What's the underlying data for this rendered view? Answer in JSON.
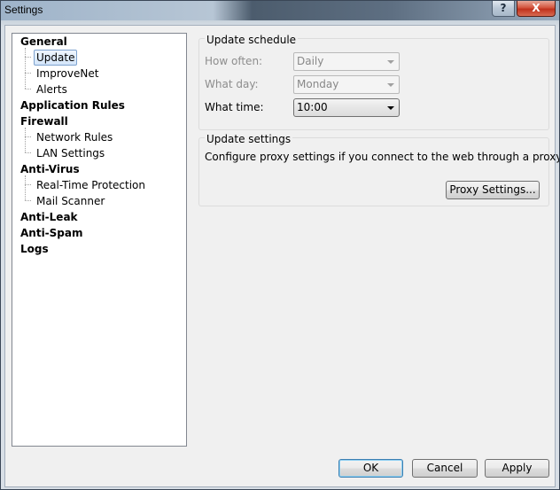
{
  "window": {
    "title": "Settings",
    "help_label": "?",
    "close_label": "X"
  },
  "tree": {
    "general": "General",
    "update": "Update",
    "improvenet": "ImproveNet",
    "alerts": "Alerts",
    "application_rules": "Application Rules",
    "firewall": "Firewall",
    "network_rules": "Network Rules",
    "lan_settings": "LAN Settings",
    "anti_virus": "Anti-Virus",
    "real_time_protection": "Real-Time Protection",
    "mail_scanner": "Mail Scanner",
    "anti_leak": "Anti-Leak",
    "anti_spam": "Anti-Spam",
    "logs": "Logs",
    "selected": "Update"
  },
  "update_schedule": {
    "title": "Update schedule",
    "how_often_label": "How often:",
    "how_often_value": "Daily",
    "what_day_label": "What day:",
    "what_day_value": "Monday",
    "what_time_label": "What time:",
    "what_time_value": "10:00"
  },
  "update_settings": {
    "title": "Update settings",
    "description": "Configure proxy settings if you connect to the web through a proxy server.",
    "proxy_button": "Proxy Settings..."
  },
  "footer": {
    "ok": "OK",
    "cancel": "Cancel",
    "apply": "Apply"
  }
}
